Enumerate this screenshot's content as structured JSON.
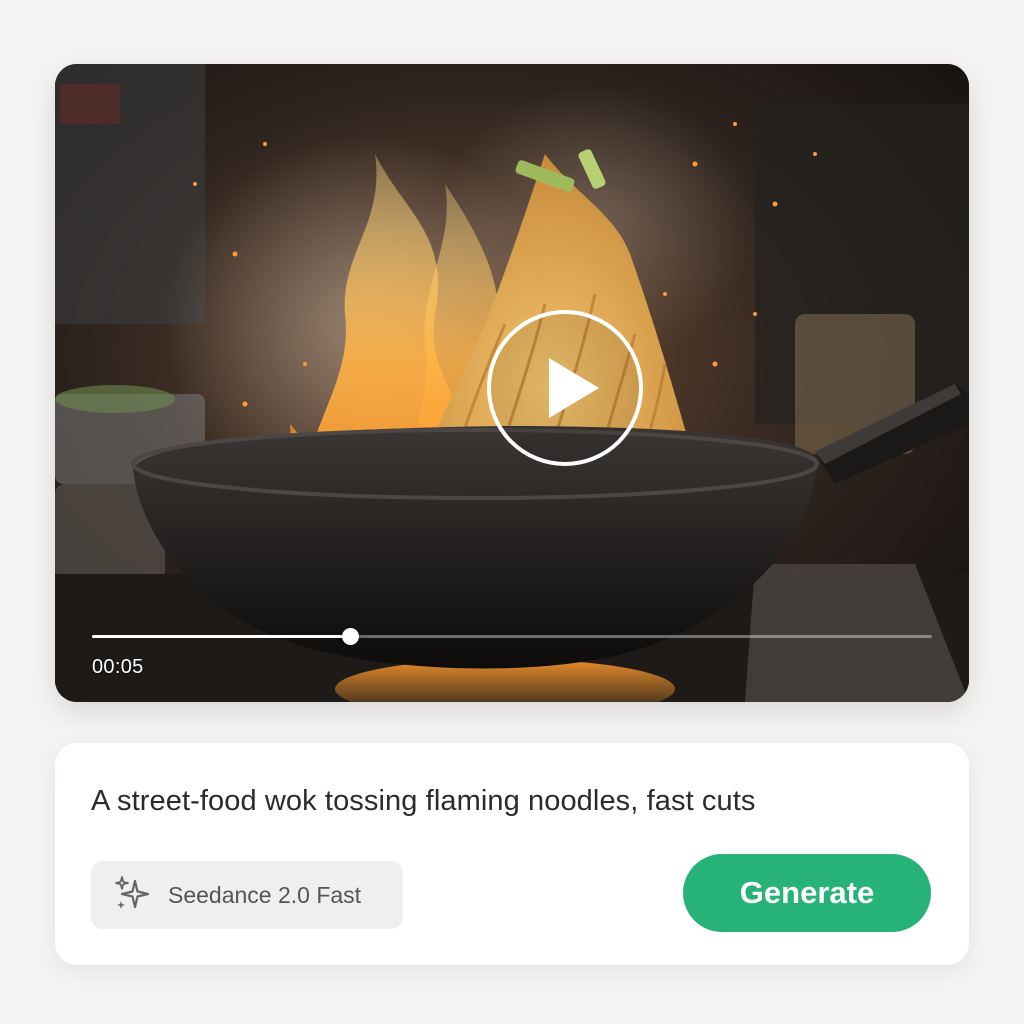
{
  "video": {
    "timestamp": "00:05",
    "progress_fraction": 0.307
  },
  "prompt": {
    "text": "A street-food wok tossing flaming noodles, fast cuts"
  },
  "model": {
    "label": "Seedance 2.0 Fast",
    "icon": "sparkle-icon"
  },
  "actions": {
    "generate_label": "Generate",
    "play_icon": "play-icon"
  },
  "colors": {
    "accent": "#27b277",
    "background": "#f5f4f2"
  }
}
